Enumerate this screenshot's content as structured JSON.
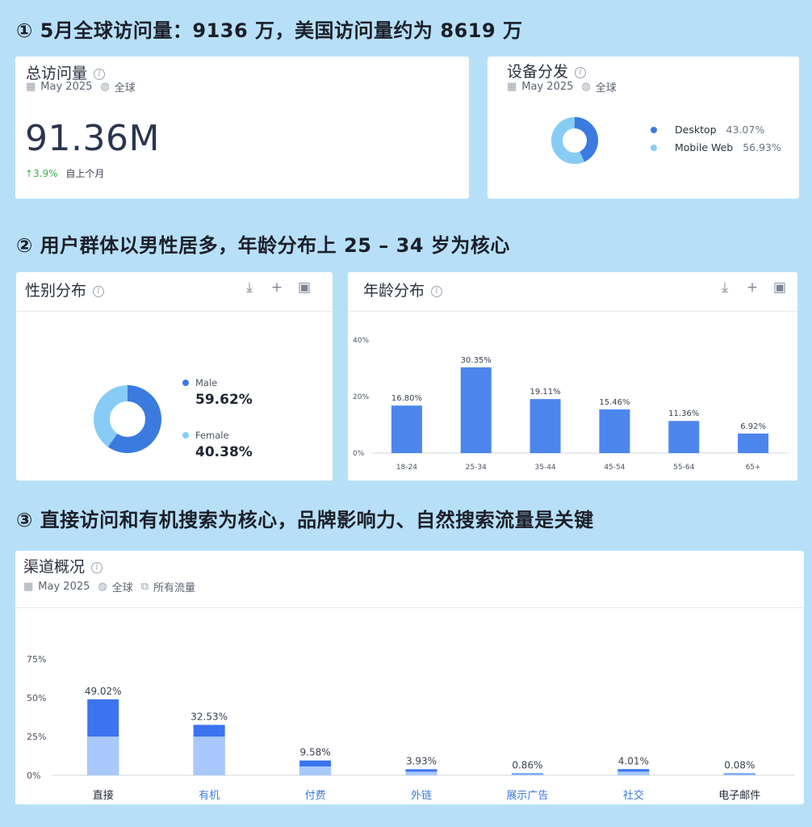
{
  "headings": {
    "h1": "① 5月全球访问量：9136 万，美国访问量约为 8619 万",
    "h2": "② 用户群体以男性居多，年龄分布上 25 – 34 岁为核心",
    "h3": "③ 直接访问和有机搜索为核心，品牌影响力、自然搜索流量是关键"
  },
  "total_visits": {
    "title": "总访问量",
    "date": "May 2025",
    "region": "全球",
    "value": "91.36M",
    "change": "↑3.9%",
    "change_label": "自上个月"
  },
  "device": {
    "title": "设备分发",
    "date": "May 2025",
    "region": "全球",
    "items": [
      {
        "label": "Desktop",
        "value": "43.07%",
        "pct": 43.07,
        "color": "#3b7be0"
      },
      {
        "label": "Mobile Web",
        "value": "56.93%",
        "pct": 56.93,
        "color": "#88ccf6"
      }
    ]
  },
  "gender": {
    "title": "性别分布",
    "items": [
      {
        "label": "Male",
        "value": "59.62%",
        "pct": 59.62,
        "color": "#3b7be0"
      },
      {
        "label": "Female",
        "value": "40.38%",
        "pct": 40.38,
        "color": "#88ccf6"
      }
    ]
  },
  "age": {
    "title": "年龄分布"
  },
  "channels": {
    "title": "渠道概况",
    "date": "May 2025",
    "region": "全球",
    "traffic": "所有流量"
  },
  "icons": {
    "calendar": "calendar-icon",
    "globe": "globe-icon",
    "traffic": "traffic-icon",
    "download": "download-icon",
    "add": "plus-icon",
    "export": "export-icon"
  },
  "chart_data": [
    {
      "type": "bar",
      "title": "年龄分布",
      "categories": [
        "18-24",
        "25-34",
        "35-44",
        "45-54",
        "55-64",
        "65+"
      ],
      "values": [
        16.8,
        30.35,
        19.11,
        15.46,
        11.36,
        6.92
      ],
      "labels": [
        "16.80%",
        "30.35%",
        "19.11%",
        "15.46%",
        "11.36%",
        "6.92%"
      ],
      "yticks": [
        "0%",
        "20%",
        "40%"
      ],
      "ylim": [
        0,
        40
      ],
      "color": "#4c86ec"
    },
    {
      "type": "bar",
      "title": "渠道概况",
      "categories": [
        "直接",
        "有机",
        "付费",
        "外链",
        "展示广告",
        "社交",
        "电子邮件"
      ],
      "values": [
        49.02,
        32.53,
        9.58,
        3.93,
        0.86,
        4.01,
        0.08
      ],
      "labels": [
        "49.02%",
        "32.53%",
        "9.58%",
        "3.93%",
        "0.86%",
        "4.01%",
        "0.08%"
      ],
      "category_colors": [
        "#1f2a3a",
        "#3b7be0",
        "#3b7be0",
        "#3b7be0",
        "#3b7be0",
        "#3b7be0",
        "#1f2a3a"
      ],
      "yticks": [
        "0%",
        "25%",
        "50%",
        "75%"
      ],
      "ylim": [
        0,
        75
      ],
      "top_color": "#3b74ee",
      "bottom_color": "#a9c8fb"
    }
  ]
}
